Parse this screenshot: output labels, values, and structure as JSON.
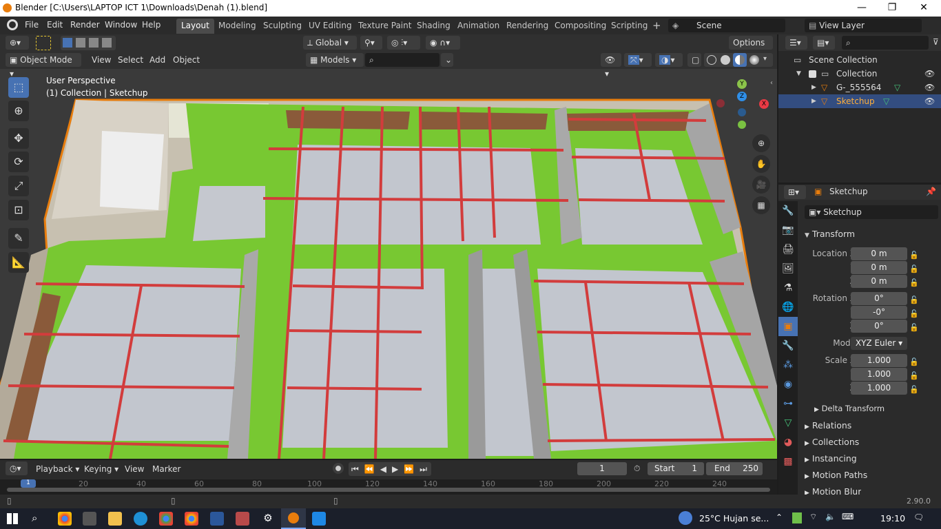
{
  "window": {
    "title": "Blender [C:\\Users\\LAPTOP ICT 1\\Downloads\\Denah (1).blend]",
    "minimize": "—",
    "maximize": "❐",
    "close": "✕"
  },
  "menu": [
    "File",
    "Edit",
    "Render",
    "Window",
    "Help"
  ],
  "workspaces": [
    "Layout",
    "Modeling",
    "Sculpting",
    "UV Editing",
    "Texture Paint",
    "Shading",
    "Animation",
    "Rendering",
    "Compositing",
    "Scripting"
  ],
  "active_workspace": "Layout",
  "add_workspace": "+",
  "scene": "Scene",
  "view_layer": "View Layer",
  "toolbar_header": {
    "transform_orientation": "Global",
    "options": "Options"
  },
  "viewport_header": {
    "mode": "Object Mode",
    "menus": [
      "View",
      "Select",
      "Add",
      "Object"
    ],
    "collection": "Models"
  },
  "viewport": {
    "perspective": "User Perspective",
    "context": "(1) Collection | Sketchup"
  },
  "gizmo": {
    "x": "X",
    "y": "Y",
    "z": "Z"
  },
  "outliner": {
    "root": "Scene Collection",
    "collection": "Collection",
    "objects": [
      "G-_555564",
      "Sketchup"
    ],
    "selected": "Sketchup"
  },
  "properties": {
    "object_name": "Sketchup",
    "header_name": "Sketchup",
    "transform_label": "Transform",
    "location_label": "Location X",
    "y_label": "Y",
    "z_label": "Z",
    "rotation_label": "Rotation X",
    "mode_label": "Mode",
    "scale_label": "Scale X",
    "location": [
      "0 m",
      "0 m",
      "0 m"
    ],
    "rotation": [
      "0°",
      "-0°",
      "0°"
    ],
    "mode": "XYZ Euler",
    "scale": [
      "1.000",
      "1.000",
      "1.000"
    ],
    "sections": [
      "Delta Transform",
      "Relations",
      "Collections",
      "Instancing",
      "Motion Paths",
      "Motion Blur"
    ]
  },
  "timeline": {
    "menus": [
      "Playback",
      "Keying",
      "View",
      "Marker"
    ],
    "current_frame": "1",
    "start_label": "Start",
    "start": "1",
    "end_label": "End",
    "end": "250",
    "ruler": [
      "1",
      "20",
      "40",
      "60",
      "80",
      "100",
      "120",
      "140",
      "160",
      "180",
      "200",
      "220",
      "240"
    ]
  },
  "status": {
    "version": "2.90.0"
  },
  "taskbar": {
    "weather": "25°C  Hujan se...",
    "time": "19:10"
  },
  "colors": {
    "accent": "#4772b3",
    "selection": "#e87d0d",
    "floor_green": "#78c832",
    "beam_red": "#d23c3c"
  }
}
